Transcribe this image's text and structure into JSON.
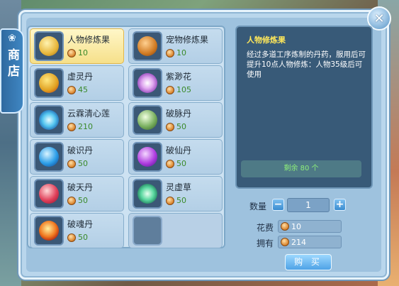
{
  "shop": {
    "tab_label": "商店",
    "items": [
      {
        "name": "人物修炼果",
        "price": "10",
        "icon": "fruit-icon",
        "selected": true
      },
      {
        "name": "宠物修炼果",
        "price": "10",
        "icon": "pet-fruit-icon"
      },
      {
        "name": "虚灵丹",
        "price": "45",
        "icon": "gourd-icon"
      },
      {
        "name": "紫渺花",
        "price": "105",
        "icon": "purple-flower-icon"
      },
      {
        "name": "云霖清心莲",
        "price": "210",
        "icon": "blue-lotus-icon"
      },
      {
        "name": "破脉丹",
        "price": "50",
        "icon": "pill-icon"
      },
      {
        "name": "破识丹",
        "price": "50",
        "icon": "blue-orb-icon"
      },
      {
        "name": "破仙丹",
        "price": "50",
        "icon": "violet-orb-icon"
      },
      {
        "name": "破天丹",
        "price": "50",
        "icon": "red-orb-icon"
      },
      {
        "name": "灵虚草",
        "price": "50",
        "icon": "herb-icon"
      },
      {
        "name": "破魂丹",
        "price": "50",
        "icon": "fire-orb-icon"
      }
    ],
    "detail": {
      "title": "人物修炼果",
      "description": "经过多道工序炼制的丹药，服用后可提升10点人物修炼：人物35级后可使用",
      "remaining": "剩余 80 个"
    },
    "quantity": {
      "label": "数量",
      "value": "1",
      "minus": "−",
      "plus": "+"
    },
    "cost": {
      "label": "花费",
      "value": "10"
    },
    "owned": {
      "label": "拥有",
      "value": "214"
    },
    "buy_label": "购 买",
    "close_label": "✕"
  }
}
